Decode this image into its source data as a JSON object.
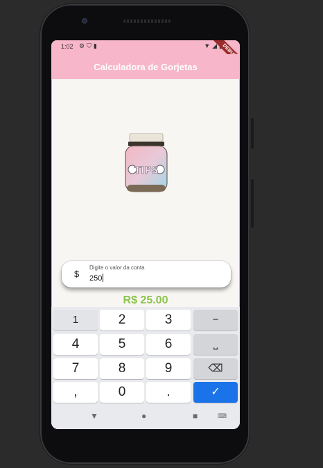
{
  "status_bar": {
    "time": "1:02",
    "left_icons": [
      "gear-icon",
      "shield-icon",
      "sd-card-icon"
    ],
    "right_icons": [
      "wifi-icon",
      "signal-icon",
      "battery-icon"
    ],
    "debug_label": "DEBUG"
  },
  "app_bar": {
    "title": "Calculadora de Gorjetas"
  },
  "jar": {
    "label": "TIPS"
  },
  "amount_field": {
    "prefix": "$",
    "label": "Digite o valor da conta",
    "value": "250"
  },
  "tip_result": "R$ 25.00",
  "keyboard": {
    "rows": [
      [
        "1",
        "2",
        "3",
        "−"
      ],
      [
        "4",
        "5",
        "6",
        "⎵"
      ],
      [
        "7",
        "8",
        "9",
        "⌫"
      ],
      [
        ",",
        "0",
        ".",
        "✓"
      ]
    ]
  },
  "nav": {
    "back": "▼",
    "home": "●",
    "recents": "■"
  },
  "colors": {
    "accent": "#f7b6c9",
    "tip": "#8bc34a",
    "done": "#1a73e8"
  }
}
